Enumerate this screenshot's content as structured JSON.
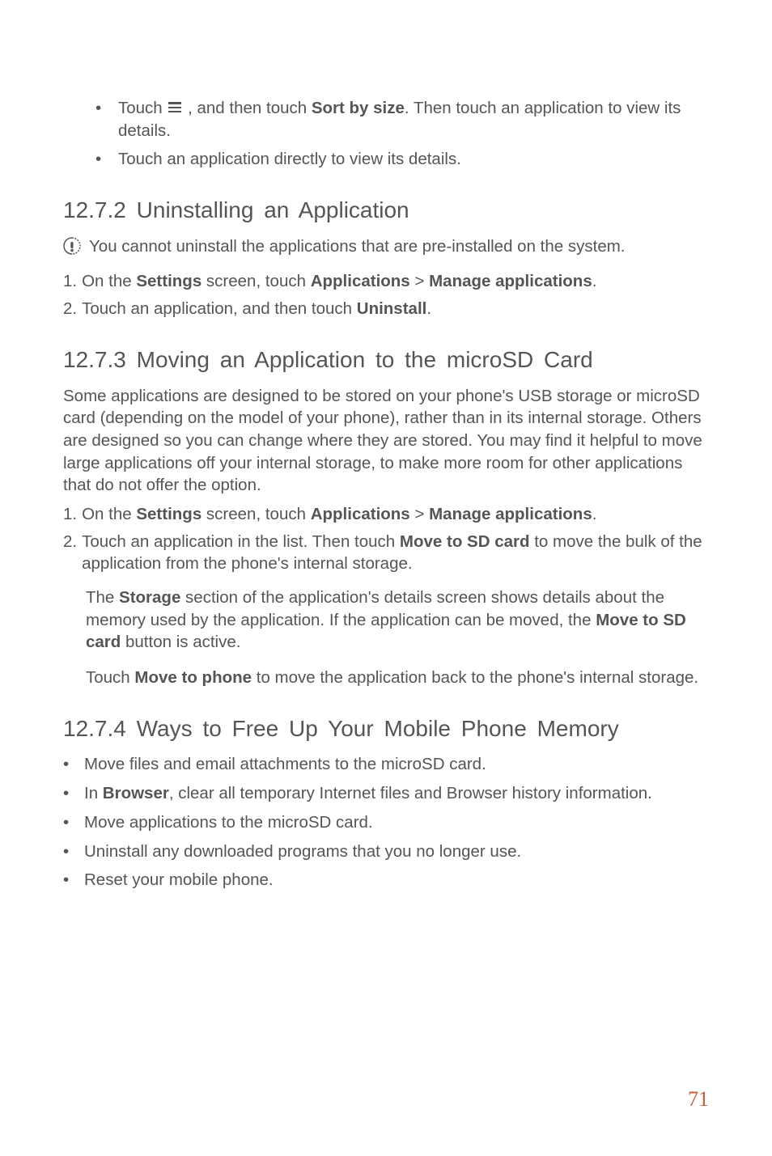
{
  "top_bullets": {
    "b1_pre": "Touch ",
    "b1_mid": " , and then touch ",
    "b1_bold": "Sort by size",
    "b1_post": ". Then touch an application to view its details.",
    "b2": "Touch an application directly to view its details."
  },
  "sec_1272": {
    "heading": "12.7.2  Uninstalling an Application",
    "callout": "You cannot uninstall the applications that are pre-installed on the system.",
    "step1_pre": "On the ",
    "step1_b1": "Settings",
    "step1_mid1": " screen, touch ",
    "step1_b2": "Applications",
    "step1_gt": " > ",
    "step1_b3": "Manage applications",
    "step1_post": ".",
    "step2_pre": "Touch an application, and then touch ",
    "step2_b1": "Uninstall",
    "step2_post": "."
  },
  "sec_1273": {
    "heading": "12.7.3  Moving an Application to the microSD Card",
    "intro": "Some applications are designed to be stored on your phone's USB storage or microSD card (depending on the model of your phone), rather than in its internal storage. Others are designed so you can change where they are stored. You may find it helpful to move large applications off your internal storage, to make more room for other applications that  do not offer the option.",
    "step1_pre": "On the ",
    "step1_b1": "Settings",
    "step1_mid1": " screen, touch ",
    "step1_b2": "Applications",
    "step1_gt": " > ",
    "step1_b3": "Manage applications",
    "step1_post": ".",
    "step2_pre": "Touch an application in the list. Then touch ",
    "step2_b1": "Move to SD card",
    "step2_post": " to move the bulk of the application from the phone's internal storage.",
    "sub_p1_pre": "The ",
    "sub_p1_b1": "Storage",
    "sub_p1_mid": " section of the application's details screen shows details about the memory used by the application. If the application can be moved, the ",
    "sub_p1_b2": "Move to SD card",
    "sub_p1_post": " button is active.",
    "sub_p2_pre": "Touch ",
    "sub_p2_b1": "Move to phone",
    "sub_p2_post": " to move the application back to the phone's internal storage."
  },
  "sec_1274": {
    "heading": "12.7.4  Ways to Free Up Your Mobile Phone Memory",
    "b1": "Move files and email attachments to the microSD card.",
    "b2_pre": "In ",
    "b2_b1": "Browser",
    "b2_post": ", clear all temporary Internet files and Browser history information.",
    "b3": "Move applications to the microSD card.",
    "b4": "Uninstall any downloaded programs that you no longer use.",
    "b5": "Reset your mobile phone."
  },
  "labels": {
    "num1": "1.",
    "num2": "2.",
    "bullet": "•"
  },
  "page_number": "71"
}
